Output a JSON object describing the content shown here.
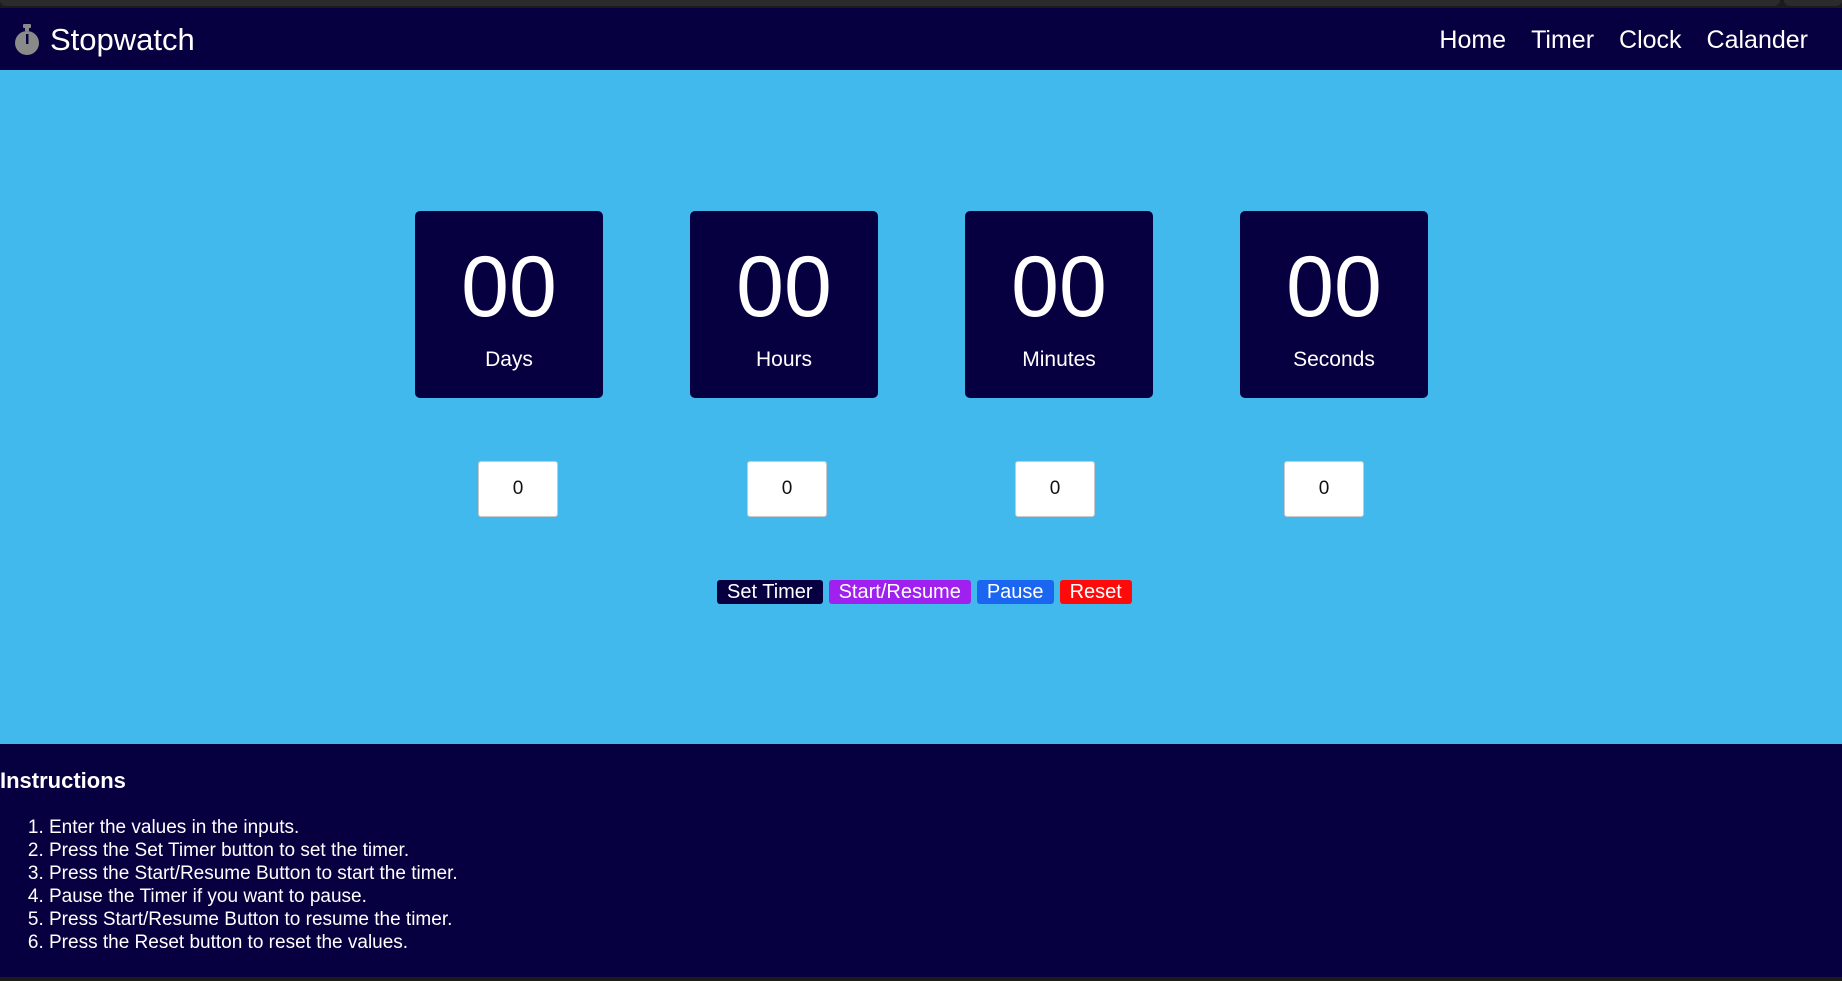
{
  "header": {
    "brand": "Stopwatch",
    "brand_icon": "stopwatch-icon",
    "nav": [
      "Home",
      "Timer",
      "Clock",
      "Calander"
    ]
  },
  "display": {
    "days": {
      "value": "00",
      "label": "Days"
    },
    "hours": {
      "value": "00",
      "label": "Hours"
    },
    "minutes": {
      "value": "00",
      "label": "Minutes"
    },
    "seconds": {
      "value": "00",
      "label": "Seconds"
    }
  },
  "inputs": {
    "days": "0",
    "hours": "0",
    "minutes": "0",
    "seconds": "0"
  },
  "buttons": {
    "set": "Set Timer",
    "start": "Start/Resume",
    "pause": "Pause",
    "reset": "Reset"
  },
  "instructions": {
    "title": "Instructions",
    "steps": [
      "Enter the values in the inputs.",
      "Press the Set Timer button to set the timer.",
      "Press the Start/Resume Button to start the timer.",
      "Pause the Timer if you want to pause.",
      "Press Start/Resume Button to resume the timer.",
      "Press the Reset button to reset the values."
    ]
  },
  "colors": {
    "navy": "#070040",
    "sky": "#41b9ec",
    "set_button": "#070040",
    "start_button": "#a020f0",
    "pause_button": "#1a66f0",
    "reset_button": "#ff0a0a"
  }
}
